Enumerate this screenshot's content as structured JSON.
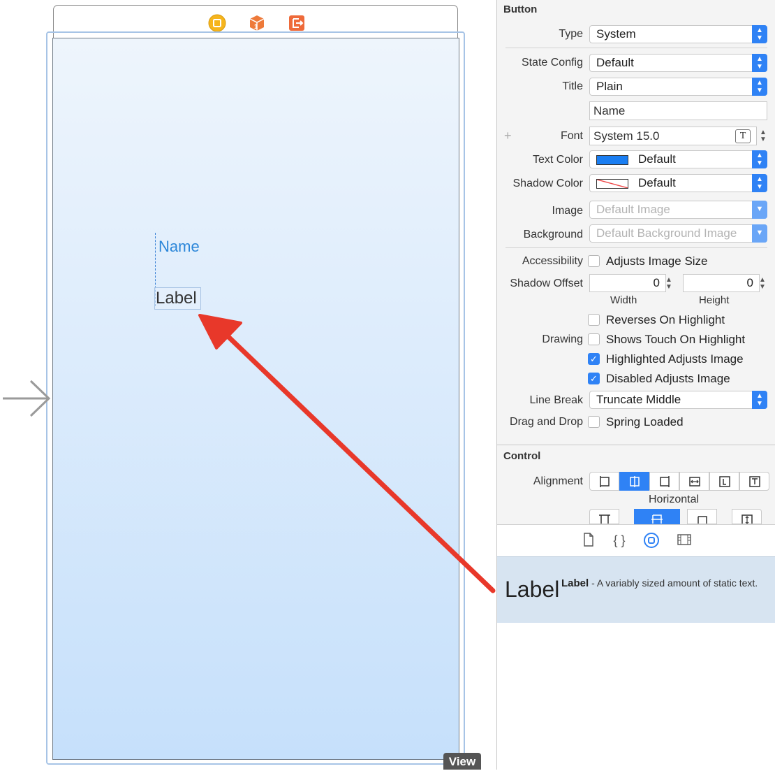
{
  "canvas": {
    "button_title": "Name",
    "label_text": "Label",
    "view_tag": "View",
    "dock_icons": [
      "view-controller-icon",
      "first-responder-icon",
      "exit-icon"
    ]
  },
  "inspector": {
    "button_section": {
      "title": "Button",
      "type_label": "Type",
      "type_value": "System",
      "state_config_label": "State Config",
      "state_config_value": "Default",
      "title_label": "Title",
      "title_value": "Plain",
      "title_text_value": "Name",
      "font_label": "Font",
      "font_value": "System 15.0",
      "text_color_label": "Text Color",
      "text_color_value": "Default",
      "text_color_swatch": "#1a7ef2",
      "shadow_color_label": "Shadow Color",
      "shadow_color_value": "Default",
      "image_label": "Image",
      "image_placeholder": "Default Image",
      "background_label": "Background",
      "background_placeholder": "Default Background Image",
      "accessibility_label": "Accessibility",
      "adjusts_image_size": "Adjusts Image Size",
      "shadow_offset_label": "Shadow Offset",
      "shadow_width": "0",
      "shadow_height": "0",
      "width_label": "Width",
      "height_label": "Height",
      "drawing_label": "Drawing",
      "reverses_on_highlight": "Reverses On Highlight",
      "shows_touch_on_highlight": "Shows Touch On Highlight",
      "highlighted_adjusts_image": "Highlighted Adjusts Image",
      "disabled_adjusts_image": "Disabled Adjusts Image",
      "line_break_label": "Line Break",
      "line_break_value": "Truncate Middle",
      "drag_drop_label": "Drag and Drop",
      "spring_loaded": "Spring Loaded"
    },
    "control_section": {
      "title": "Control",
      "alignment_label": "Alignment",
      "horizontal_label": "Horizontal",
      "selected_horizontal": 1,
      "selected_vertical": 1
    }
  },
  "library": {
    "tabs": [
      "file-icon",
      "braces-icon",
      "object-library-icon",
      "media-library-icon"
    ],
    "selected_tab": 2,
    "item_preview": "Label",
    "item_name": "Label",
    "item_description": " - A variably sized amount of static text."
  },
  "colors": {
    "accent": "#2f82f5",
    "arrow": "#e8382a"
  }
}
